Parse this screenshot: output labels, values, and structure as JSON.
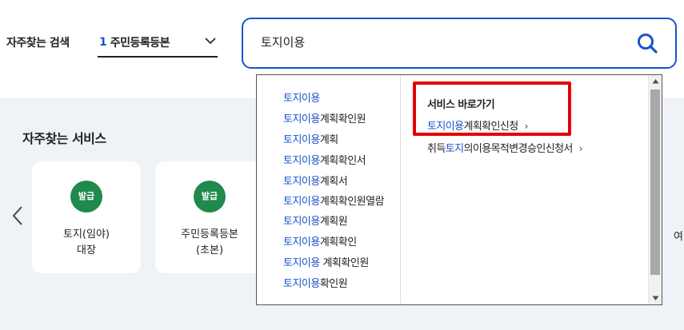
{
  "header": {
    "frequent_search_label": "자주찾는 검색",
    "frequent_select": {
      "rank": "1",
      "text": "주민등록등본"
    },
    "search": {
      "value": "토지이용"
    }
  },
  "services": {
    "title": "자주찾는 서비스",
    "cards": [
      {
        "badge": "발급",
        "name": "토지(임야)\n대장"
      },
      {
        "badge": "발급",
        "name": "주민등록등본\n(초본)"
      }
    ],
    "edge_text": "여"
  },
  "autocomplete": {
    "suggestions": [
      {
        "highlight": "토지이용",
        "rest": ""
      },
      {
        "highlight": "토지이용",
        "rest": "계획확인원"
      },
      {
        "highlight": "토지이용",
        "rest": "계획"
      },
      {
        "highlight": "토지이용",
        "rest": "계획확인서"
      },
      {
        "highlight": "토지이용",
        "rest": "계획서"
      },
      {
        "highlight": "토지이용",
        "rest": "계획확인원열람"
      },
      {
        "highlight": "토지이용",
        "rest": "계획원"
      },
      {
        "highlight": "토지이용",
        "rest": "계획확인"
      },
      {
        "highlight": "토지이용",
        "rest": " 계획확인원"
      },
      {
        "highlight": "토지이용",
        "rest": "확인원"
      }
    ],
    "quick": {
      "title": "서비스 바로가기",
      "links": [
        {
          "prefix": "",
          "highlight": "토지이용",
          "rest": "계획확인신청",
          "arrow": "›"
        },
        {
          "prefix": "취득",
          "highlight": "토지",
          "rest": "의이용목적변경승인신청서",
          "arrow": "›"
        }
      ]
    }
  },
  "colors": {
    "brand_blue": "#1a53c9",
    "badge_green": "#1f8a4c",
    "highlight_red": "#e30000",
    "section_bg": "#eff2f6"
  },
  "icons": {
    "search": "search-icon",
    "chevron": "chevron-down-icon",
    "carousel_prev": "chevron-left-icon"
  }
}
